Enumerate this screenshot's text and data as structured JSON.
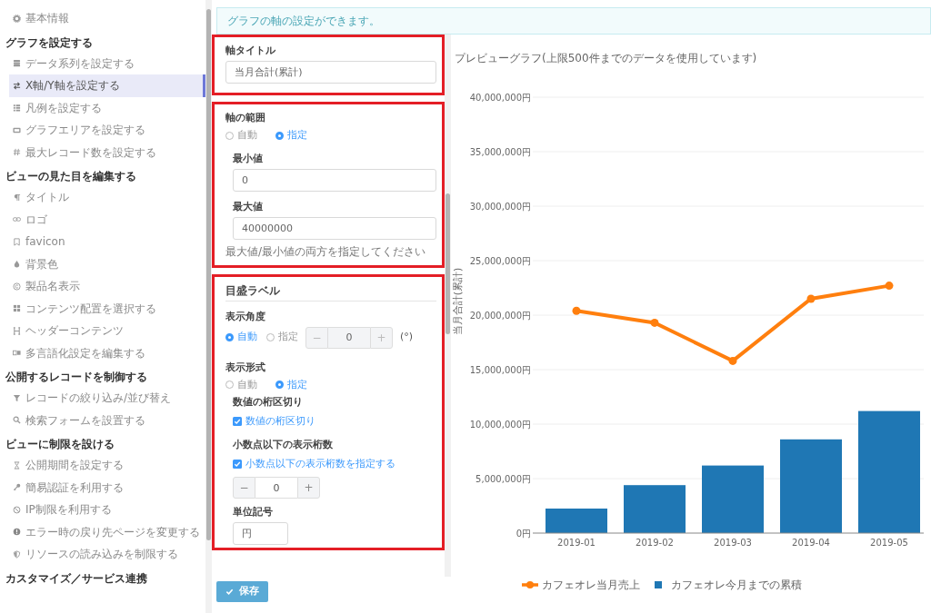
{
  "sidebar": {
    "sections": [
      {
        "items": [
          {
            "label": "基本情報",
            "selected": false
          }
        ]
      },
      {
        "heading": "グラフを設定する",
        "items": [
          {
            "label": "データ系列を設定する",
            "selected": false
          },
          {
            "label": "X軸/Y軸を設定する",
            "selected": true
          },
          {
            "label": "凡例を設定する",
            "selected": false
          },
          {
            "label": "グラフエリアを設定する",
            "selected": false
          },
          {
            "label": "最大レコード数を設定する",
            "selected": false
          }
        ]
      },
      {
        "heading": "ビューの見た目を編集する",
        "items": [
          {
            "label": "タイトル",
            "selected": false
          },
          {
            "label": "ロゴ",
            "selected": false
          },
          {
            "label": "favicon",
            "selected": false
          },
          {
            "label": "背景色",
            "selected": false
          },
          {
            "label": "製品名表示",
            "selected": false
          },
          {
            "label": "コンテンツ配置を選択する",
            "selected": false
          },
          {
            "label": "ヘッダーコンテンツ",
            "selected": false
          },
          {
            "label": "多言語化設定を編集する",
            "selected": false
          }
        ]
      },
      {
        "heading": "公開するレコードを制御する",
        "items": [
          {
            "label": "レコードの絞り込み/並び替え",
            "selected": false
          },
          {
            "label": "検索フォームを設置する",
            "selected": false
          }
        ]
      },
      {
        "heading": "ビューに制限を設ける",
        "items": [
          {
            "label": "公開期間を設定する",
            "selected": false
          },
          {
            "label": "簡易認証を利用する",
            "selected": false
          },
          {
            "label": "IP制限を利用する",
            "selected": false
          },
          {
            "label": "エラー時の戻り先ページを変更する",
            "selected": false
          },
          {
            "label": "リソースの読み込みを制限する",
            "selected": false
          }
        ]
      },
      {
        "heading": "カスタマイズ／サービス連携"
      }
    ]
  },
  "info_alert": "グラフの軸の設定ができます。",
  "form": {
    "axis_title": {
      "label": "軸タイトル",
      "value": "当月合計(累計)"
    },
    "axis_range": {
      "label": "軸の範囲",
      "options": [
        {
          "label": "自動",
          "selected": false
        },
        {
          "label": "指定",
          "selected": true
        }
      ],
      "min": {
        "label": "最小値",
        "value": "0"
      },
      "max": {
        "label": "最大値",
        "value": "40000000"
      },
      "help": "最大値/最小値の両方を指定してください"
    },
    "tick_labels": {
      "heading": "目盛ラベル",
      "angle": {
        "label": "表示角度",
        "options": [
          {
            "label": "自動",
            "selected": true
          },
          {
            "label": "指定",
            "selected": false
          }
        ],
        "stepper": {
          "minus": "−",
          "value": "0",
          "plus": "+",
          "disabled": true
        },
        "unit": "(°)"
      },
      "format": {
        "label": "表示形式",
        "options": [
          {
            "label": "自動",
            "selected": false
          },
          {
            "label": "指定",
            "selected": true
          }
        ],
        "thousands": {
          "label": "数値の桁区切り",
          "checkbox": {
            "label": "数値の桁区切り",
            "checked": true
          }
        },
        "decimals": {
          "label": "小数点以下の表示桁数",
          "checkbox": {
            "label": "小数点以下の表示桁数を指定する",
            "checked": true
          },
          "stepper": {
            "minus": "−",
            "value": "0",
            "plus": "+",
            "disabled": false
          }
        },
        "unit_symbol": {
          "label": "単位記号",
          "value": "円"
        }
      }
    }
  },
  "save_button": "保存",
  "chart": {
    "chart_data": {
      "type": "bar",
      "title": "プレビューグラフ(上限500件までのデータを使用しています)",
      "ylabel": "当月合計(累計)",
      "categories": [
        "2019-01",
        "2019-02",
        "2019-03",
        "2019-04",
        "2019-05"
      ],
      "series": [
        {
          "name": "カフェオレ当月売上",
          "type": "line",
          "marker": "circle",
          "color": "#ff7f0e",
          "values": [
            20400000,
            19300000,
            15800000,
            21500000,
            22700000
          ]
        },
        {
          "name": "カフェオレ今月までの累積",
          "type": "bar",
          "color": "#1f77b4",
          "values": [
            2250000,
            4400000,
            6200000,
            8600000,
            11200000
          ]
        }
      ],
      "ylim": [
        0,
        40000000
      ],
      "grid": true,
      "legend": true,
      "yticks": [
        {
          "value": 0,
          "label": "0円"
        },
        {
          "value": 5000000,
          "label": "5,000,000円"
        },
        {
          "value": 10000000,
          "label": "10,000,000円"
        },
        {
          "value": 15000000,
          "label": "15,000,000円"
        },
        {
          "value": 20000000,
          "label": "20,000,000円"
        },
        {
          "value": 25000000,
          "label": "25,000,000円"
        },
        {
          "value": 30000000,
          "label": "30,000,000円"
        },
        {
          "value": 35000000,
          "label": "35,000,000円"
        },
        {
          "value": 40000000,
          "label": "40,000,000円"
        }
      ]
    }
  }
}
